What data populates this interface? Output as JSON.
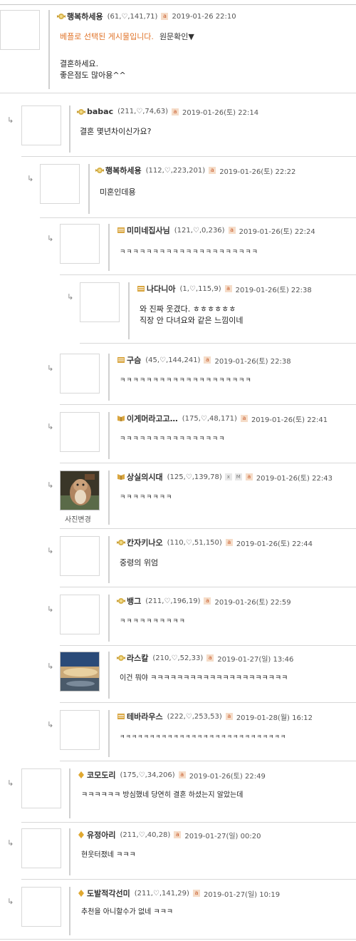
{
  "comments": [
    {
      "nickname": "행복하세용",
      "stats": "(61,♡,141,71)",
      "datetime": "2019-01-26 22:10",
      "selected_notice": "베플로 선택된 게시물입니다.",
      "original_link": "원문확인▼",
      "lines": [
        "결혼하세요.",
        "좋은점도 많아용^^"
      ]
    },
    {
      "nickname": "babac",
      "stats": "(211,♡,74,63)",
      "datetime": "2019-01-26(토) 22:14",
      "lines": [
        "결혼 몇년차이신가요?"
      ]
    },
    {
      "nickname": "행복하세용",
      "stats": "(112,♡,223,201)",
      "datetime": "2019-01-26(토) 22:22",
      "lines": [
        "미혼인데용"
      ]
    },
    {
      "nickname": "미미네집사님",
      "stats": "(121,♡,0,236)",
      "datetime": "2019-01-26(토) 22:24",
      "lines": [
        "ㅋㅋㅋㅋㅋㅋㅋㅋㅋㅋㅋㅋㅋㅋㅋㅋㅋㅋㅋㅋㅋ"
      ]
    },
    {
      "nickname": "나다니아",
      "stats": "(1,♡,115,9)",
      "datetime": "2019-01-26(토) 22:38",
      "lines": [
        "와 진짜 웃겼다. ㅎㅎㅎㅎㅎㅎ",
        "직장 안 다녀요와 같은 느낌이네"
      ]
    },
    {
      "nickname": "구슴",
      "stats": "(45,♡,144,241)",
      "datetime": "2019-01-26(토) 22:38",
      "lines": [
        "ㅋㅋㅋㅋㅋㅋㅋㅋㅋㅋㅋㅋㅋㅋㅋㅋㅋㅋㅋㅋ"
      ]
    },
    {
      "nickname": "이게머라고고…",
      "stats": "(175,♡,48,171)",
      "datetime": "2019-01-26(토) 22:41",
      "lines": [
        "ㅋㅋㅋㅋㅋㅋㅋㅋㅋㅋㅋㅋㅋㅋㅋㅋ"
      ]
    },
    {
      "nickname": "상실의시대",
      "stats": "(125,♡,139,78)",
      "datetime": "2019-01-26(토) 22:43",
      "lines": [
        "ㅋㅋㅋㅋㅋㅋㅋㅋ"
      ],
      "avatar_caption": "사진변경"
    },
    {
      "nickname": "칸자키나오",
      "stats": "(110,♡,51,150)",
      "datetime": "2019-01-26(토) 22:44",
      "lines": [
        "중령의 위엄"
      ]
    },
    {
      "nickname": "뱅그",
      "stats": "(211,♡,196,19)",
      "datetime": "2019-01-26(토) 22:59",
      "lines": [
        "ㅋㅋㅋㅋㅋㅋㅋㅋㅋㅋ"
      ]
    },
    {
      "nickname": "라스칼",
      "stats": "(210,♡,52,33)",
      "datetime": "2019-01-27(일) 13:46",
      "lines": [
        "이건 뭐야 ㅋㅋㅋㅋㅋㅋㅋㅋㅋㅋㅋㅋㅋㅋㅋㅋㅋㅋㅋㅋㅋ"
      ]
    },
    {
      "nickname": "테바라우스",
      "stats": "(222,♡,253,53)",
      "datetime": "2019-01-28(월) 16:12",
      "lines": [
        "ㅋㅋㅋㅋㅋㅋㅋㅋㅋㅋㅋㅋㅋㅋㅋㅋㅋㅋㅋㅋㅋㅋㅋㅋㅋㅋㅋㅋ"
      ]
    },
    {
      "nickname": "코모도리",
      "stats": "(175,♡,34,206)",
      "datetime": "2019-01-26(토) 22:49",
      "lines": [
        "ㅋㅋㅋㅋㅋㅋ 방심했네 당연히 결혼 하셨는지 알았는데"
      ]
    },
    {
      "nickname": "유정아리",
      "stats": "(211,♡,40,28)",
      "datetime": "2019-01-27(일) 00:20",
      "lines": [
        "현웃터졌네 ㅋㅋㅋ"
      ]
    },
    {
      "nickname": "도발적각선미",
      "stats": "(211,♡,141,29)",
      "datetime": "2019-01-27(일) 10:19",
      "lines": [
        "추천을 아니할수가 없네 ㅋㅋㅋ"
      ]
    }
  ],
  "icons": {
    "medal": "medal-icon",
    "book": "book-icon",
    "ribbon": "ribbon-icon",
    "diamond": "diamond-icon",
    "a_badge": "a",
    "x_badge": "x",
    "m_badge": "M"
  },
  "colors": {
    "selected_notice": "#e0742a",
    "a_badge_bg": "#f5dcc8",
    "a_badge_fg": "#c85a2a",
    "separator": "#d8d8d8"
  }
}
